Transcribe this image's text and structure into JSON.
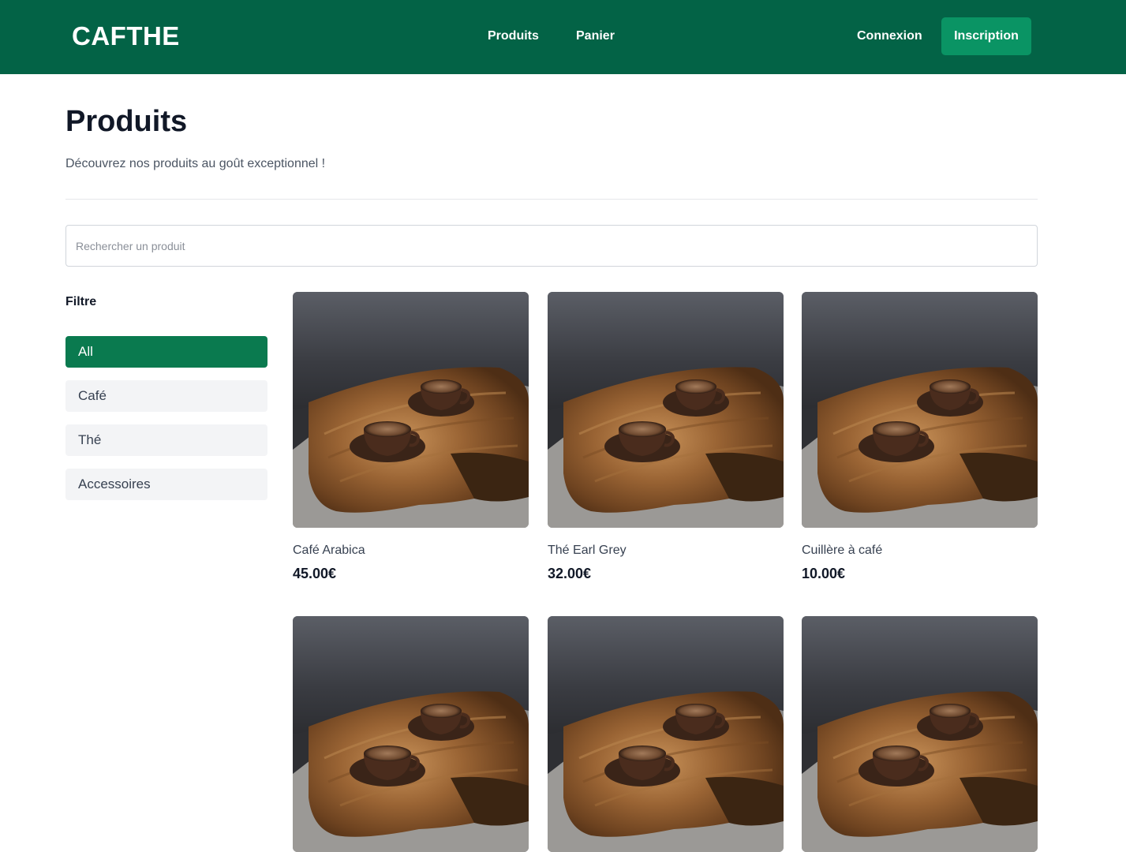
{
  "navbar": {
    "brand": "CAFTHE",
    "links": [
      "Produits",
      "Panier"
    ],
    "login": "Connexion",
    "signup": "Inscription"
  },
  "page": {
    "title": "Produits",
    "subtitle": "Découvrez nos produits au goût exceptionnel !"
  },
  "search": {
    "placeholder": "Rechercher un produit",
    "value": ""
  },
  "filter": {
    "title": "Filtre",
    "options": [
      "All",
      "Café",
      "Thé",
      "Accessoires"
    ],
    "selected": "All"
  },
  "products": [
    {
      "name": "Café Arabica",
      "price": "45.00€",
      "image": "coffee-cups-on-wooden-table"
    },
    {
      "name": "Thé Earl Grey",
      "price": "32.00€",
      "image": "coffee-cups-on-wooden-table"
    },
    {
      "name": "Cuillère à café",
      "price": "10.00€",
      "image": "coffee-cups-on-wooden-table"
    },
    {
      "image": "coffee-cups-on-wooden-table"
    },
    {
      "image": "coffee-cups-on-wooden-table"
    },
    {
      "image": "coffee-cups-on-wooden-table"
    }
  ],
  "colors": {
    "navbar": "#036346",
    "signup_button": "#0a9464",
    "filter_active": "#0a7a4f"
  }
}
